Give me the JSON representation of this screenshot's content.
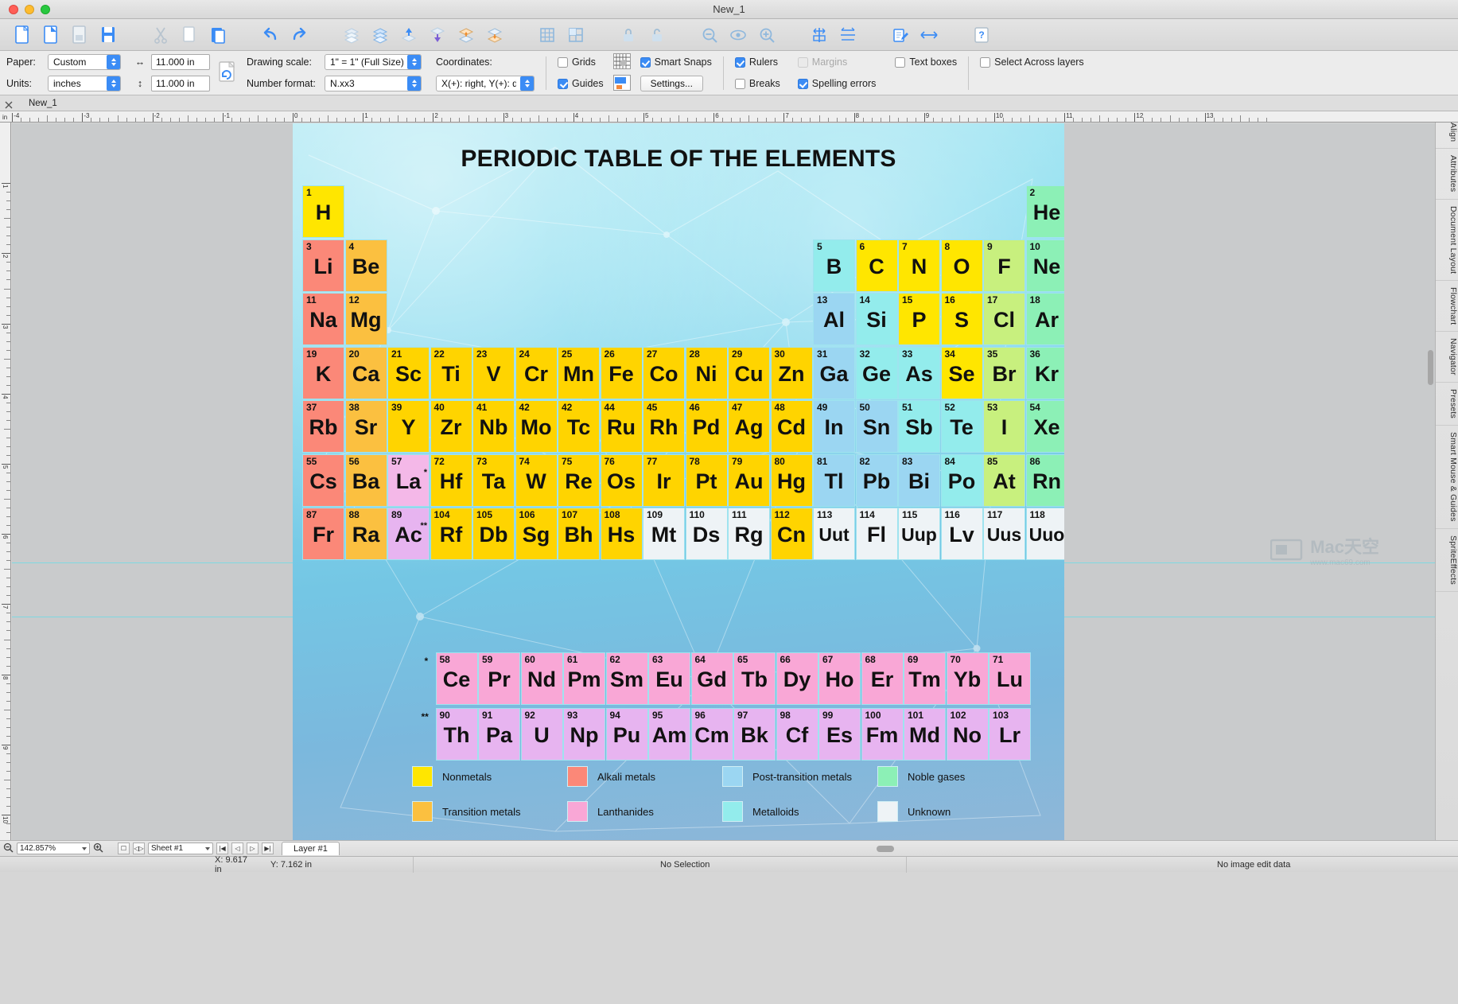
{
  "window": {
    "title": "New_1"
  },
  "titlebar": {
    "close": "close",
    "minimize": "minimize",
    "zoom": "zoom"
  },
  "toolbar": {
    "buttons": [
      {
        "name": "new-document-icon",
        "label": "New"
      },
      {
        "name": "new-from-template-icon",
        "label": "New from template"
      },
      {
        "name": "open-document-icon",
        "label": "Open"
      },
      {
        "name": "save-document-icon",
        "label": "Save"
      },
      {
        "name": "cut-icon",
        "label": "Cut"
      },
      {
        "name": "copy-icon",
        "label": "Copy"
      },
      {
        "name": "paste-icon",
        "label": "Paste"
      },
      {
        "name": "undo-icon",
        "label": "Undo"
      },
      {
        "name": "redo-icon",
        "label": "Redo"
      },
      {
        "name": "bring-to-front-icon",
        "label": "Bring to front"
      },
      {
        "name": "send-to-back-icon",
        "label": "Send to back"
      },
      {
        "name": "bring-forward-icon",
        "label": "Bring forward"
      },
      {
        "name": "send-backward-icon",
        "label": "Send backward"
      },
      {
        "name": "group-icon",
        "label": "Group"
      },
      {
        "name": "ungroup-icon",
        "label": "Ungroup"
      },
      {
        "name": "grid-icon",
        "label": "Grid"
      },
      {
        "name": "grid-settings-icon",
        "label": "Grid settings"
      },
      {
        "name": "lock-icon",
        "label": "Lock"
      },
      {
        "name": "unlock-icon",
        "label": "Unlock"
      },
      {
        "name": "zoom-out-icon",
        "label": "Zoom out"
      },
      {
        "name": "preview-icon",
        "label": "Preview"
      },
      {
        "name": "zoom-in-icon",
        "label": "Zoom in"
      },
      {
        "name": "align-vertical-icon",
        "label": "Align vertical"
      },
      {
        "name": "align-horizontal-icon",
        "label": "Align horizontal"
      },
      {
        "name": "edit-text-icon",
        "label": "Edit text"
      },
      {
        "name": "link-icon",
        "label": "Link"
      },
      {
        "name": "help-icon",
        "label": "Help"
      }
    ]
  },
  "options": {
    "paper_label": "Paper:",
    "paper_value": "Custom",
    "units_label": "Units:",
    "units_value": "inches",
    "width_value": "11.000 in",
    "height_value": "11.000 in",
    "rotate_page_icon": "rotate-page-icon",
    "drawing_scale_label": "Drawing scale:",
    "drawing_scale_value": "1\" = 1\"   (Full Size)",
    "number_format_label": "Number format:",
    "number_format_value": "N.xx3",
    "coordinates_label": "Coordinates:",
    "coordinates_value": "X(+): right, Y(+): down",
    "checks": [
      {
        "label": "Grids",
        "checked": false,
        "disabled": false
      },
      {
        "label": "Guides",
        "checked": true,
        "disabled": false
      },
      {
        "label": "Smart Snaps",
        "checked": true,
        "disabled": false
      },
      {
        "label": "Rulers",
        "checked": true,
        "disabled": false
      },
      {
        "label": "Breaks",
        "checked": false,
        "disabled": false
      },
      {
        "label": "Margins",
        "checked": false,
        "disabled": true
      },
      {
        "label": "Spelling errors",
        "checked": true,
        "disabled": false
      },
      {
        "label": "Text boxes",
        "checked": false,
        "disabled": false
      },
      {
        "label": "Select Across layers",
        "checked": false,
        "disabled": false
      }
    ],
    "settings_button": "Settings...",
    "grid_preview_icon": "grid-preview-icon",
    "guide_preview_icon": "guide-preview-icon"
  },
  "tabs": {
    "close_icon": "close-tab-icon",
    "document_tab": "New_1"
  },
  "right_panel": {
    "tabs": [
      "Align",
      "Attributes",
      "Document Layout",
      "Flowchart",
      "Navigator",
      "Presets",
      "Smart Mouse & Guides",
      "SpriteEffects"
    ]
  },
  "bottom": {
    "zoom_value": "142.857%",
    "zoom_out_icon": "zoom-out-icon",
    "zoom_in_icon": "zoom-in-icon",
    "page_icon": "page-icon",
    "page_nav_icon": "page-nav-icon",
    "sheet_value": "Sheet #1",
    "nav_first": "|◀",
    "nav_prev": "◁",
    "nav_next": "▷",
    "nav_last": "▶|",
    "layer_tab": "Layer #1"
  },
  "statusbar": {
    "x_coord": "X: 9.617 in",
    "y_coord": "Y: 7.162 in",
    "selection": "No Selection",
    "image_edit": "No image edit data"
  },
  "watermark": {
    "brand": "Mac天空",
    "url": "www.mac69.com"
  },
  "document": {
    "title": "PERIODIC TABLE OF THE ELEMENTS",
    "colors": {
      "nonmetals": "#ffe600",
      "alkali_metals": "#fb8878",
      "post_transition": "#9bd6f2",
      "noble_gases": "#8cf0b6",
      "transition_metals": "#fbc93b",
      "lanthanides": "#f9a7d6",
      "metalloids": "#93ecec",
      "unknown": "#eef3f6",
      "alkaline_earth": "#fbc040",
      "actinides": "#e7b4f0",
      "halogens": "#c8f07e",
      "border": "#9fe3ef"
    },
    "legend": [
      {
        "label": "Nonmetals",
        "color": "#ffe600"
      },
      {
        "label": "Alkali metals",
        "color": "#fb8878"
      },
      {
        "label": "Post-transition metals",
        "color": "#9bd6f2"
      },
      {
        "label": "Noble gases",
        "color": "#8cf0b6"
      },
      {
        "label": "Transition metals",
        "color": "#fbc040"
      },
      {
        "label": "Lanthanides",
        "color": "#f9a7d6"
      },
      {
        "label": "Metalloids",
        "color": "#93ecec"
      },
      {
        "label": "Unknown",
        "color": "#eef3f6"
      }
    ],
    "markers": {
      "lanthanide_mark": "*",
      "actinide_mark": "**"
    },
    "elements": [
      {
        "num": "1",
        "sym": "H",
        "col": 1,
        "row": 1,
        "color": "#ffe600"
      },
      {
        "num": "2",
        "sym": "He",
        "col": 18,
        "row": 1,
        "color": "#8cf0b6"
      },
      {
        "num": "3",
        "sym": "Li",
        "col": 1,
        "row": 2,
        "color": "#fb8878"
      },
      {
        "num": "4",
        "sym": "Be",
        "col": 2,
        "row": 2,
        "color": "#fbc040"
      },
      {
        "num": "5",
        "sym": "B",
        "col": 13,
        "row": 2,
        "color": "#93ecec"
      },
      {
        "num": "6",
        "sym": "C",
        "col": 14,
        "row": 2,
        "color": "#ffe600"
      },
      {
        "num": "7",
        "sym": "N",
        "col": 15,
        "row": 2,
        "color": "#ffe600"
      },
      {
        "num": "8",
        "sym": "O",
        "col": 16,
        "row": 2,
        "color": "#ffe600"
      },
      {
        "num": "9",
        "sym": "F",
        "col": 17,
        "row": 2,
        "color": "#c8f07e"
      },
      {
        "num": "10",
        "sym": "Ne",
        "col": 18,
        "row": 2,
        "color": "#8cf0b6"
      },
      {
        "num": "11",
        "sym": "Na",
        "col": 1,
        "row": 3,
        "color": "#fb8878"
      },
      {
        "num": "12",
        "sym": "Mg",
        "col": 2,
        "row": 3,
        "color": "#fbc040"
      },
      {
        "num": "13",
        "sym": "Al",
        "col": 13,
        "row": 3,
        "color": "#9bd6f2"
      },
      {
        "num": "14",
        "sym": "Si",
        "col": 14,
        "row": 3,
        "color": "#93ecec"
      },
      {
        "num": "15",
        "sym": "P",
        "col": 15,
        "row": 3,
        "color": "#ffe600"
      },
      {
        "num": "16",
        "sym": "S",
        "col": 16,
        "row": 3,
        "color": "#ffe600"
      },
      {
        "num": "17",
        "sym": "Cl",
        "col": 17,
        "row": 3,
        "color": "#c8f07e"
      },
      {
        "num": "18",
        "sym": "Ar",
        "col": 18,
        "row": 3,
        "color": "#8cf0b6"
      },
      {
        "num": "19",
        "sym": "K",
        "col": 1,
        "row": 4,
        "color": "#fb8878"
      },
      {
        "num": "20",
        "sym": "Ca",
        "col": 2,
        "row": 4,
        "color": "#fbc040"
      },
      {
        "num": "21",
        "sym": "Sc",
        "col": 3,
        "row": 4,
        "color": "#ffd400"
      },
      {
        "num": "22",
        "sym": "Ti",
        "col": 4,
        "row": 4,
        "color": "#ffd400"
      },
      {
        "num": "23",
        "sym": "V",
        "col": 5,
        "row": 4,
        "color": "#ffd400"
      },
      {
        "num": "24",
        "sym": "Cr",
        "col": 6,
        "row": 4,
        "color": "#ffd400"
      },
      {
        "num": "25",
        "sym": "Mn",
        "col": 7,
        "row": 4,
        "color": "#ffd400"
      },
      {
        "num": "26",
        "sym": "Fe",
        "col": 8,
        "row": 4,
        "color": "#ffd400"
      },
      {
        "num": "27",
        "sym": "Co",
        "col": 9,
        "row": 4,
        "color": "#ffd400"
      },
      {
        "num": "28",
        "sym": "Ni",
        "col": 10,
        "row": 4,
        "color": "#ffd400"
      },
      {
        "num": "29",
        "sym": "Cu",
        "col": 11,
        "row": 4,
        "color": "#ffd400"
      },
      {
        "num": "30",
        "sym": "Zn",
        "col": 12,
        "row": 4,
        "color": "#ffd400"
      },
      {
        "num": "31",
        "sym": "Ga",
        "col": 13,
        "row": 4,
        "color": "#9bd6f2"
      },
      {
        "num": "32",
        "sym": "Ge",
        "col": 14,
        "row": 4,
        "color": "#93ecec"
      },
      {
        "num": "33",
        "sym": "As",
        "col": 15,
        "row": 4,
        "color": "#93ecec"
      },
      {
        "num": "34",
        "sym": "Se",
        "col": 16,
        "row": 4,
        "color": "#ffe600"
      },
      {
        "num": "35",
        "sym": "Br",
        "col": 17,
        "row": 4,
        "color": "#c8f07e"
      },
      {
        "num": "36",
        "sym": "Kr",
        "col": 18,
        "row": 4,
        "color": "#8cf0b6"
      },
      {
        "num": "37",
        "sym": "Rb",
        "col": 1,
        "row": 5,
        "color": "#fb8878"
      },
      {
        "num": "38",
        "sym": "Sr",
        "col": 2,
        "row": 5,
        "color": "#fbc040"
      },
      {
        "num": "39",
        "sym": "Y",
        "col": 3,
        "row": 5,
        "color": "#ffd400"
      },
      {
        "num": "40",
        "sym": "Zr",
        "col": 4,
        "row": 5,
        "color": "#ffd400"
      },
      {
        "num": "41",
        "sym": "Nb",
        "col": 5,
        "row": 5,
        "color": "#ffd400"
      },
      {
        "num": "42",
        "sym": "Mo",
        "col": 6,
        "row": 5,
        "color": "#ffd400"
      },
      {
        "num": "42",
        "sym": "Tc",
        "col": 7,
        "row": 5,
        "color": "#ffd400"
      },
      {
        "num": "44",
        "sym": "Ru",
        "col": 8,
        "row": 5,
        "color": "#ffd400"
      },
      {
        "num": "45",
        "sym": "Rh",
        "col": 9,
        "row": 5,
        "color": "#ffd400"
      },
      {
        "num": "46",
        "sym": "Pd",
        "col": 10,
        "row": 5,
        "color": "#ffd400"
      },
      {
        "num": "47",
        "sym": "Ag",
        "col": 11,
        "row": 5,
        "color": "#ffd400"
      },
      {
        "num": "48",
        "sym": "Cd",
        "col": 12,
        "row": 5,
        "color": "#ffd400"
      },
      {
        "num": "49",
        "sym": "In",
        "col": 13,
        "row": 5,
        "color": "#9bd6f2"
      },
      {
        "num": "50",
        "sym": "Sn",
        "col": 14,
        "row": 5,
        "color": "#9bd6f2"
      },
      {
        "num": "51",
        "sym": "Sb",
        "col": 15,
        "row": 5,
        "color": "#93ecec"
      },
      {
        "num": "52",
        "sym": "Te",
        "col": 16,
        "row": 5,
        "color": "#93ecec"
      },
      {
        "num": "53",
        "sym": "I",
        "col": 17,
        "row": 5,
        "color": "#c8f07e"
      },
      {
        "num": "54",
        "sym": "Xe",
        "col": 18,
        "row": 5,
        "color": "#8cf0b6"
      },
      {
        "num": "55",
        "sym": "Cs",
        "col": 1,
        "row": 6,
        "color": "#fb8878"
      },
      {
        "num": "56",
        "sym": "Ba",
        "col": 2,
        "row": 6,
        "color": "#fbc040"
      },
      {
        "num": "57",
        "sym": "La",
        "col": 3,
        "row": 6,
        "color": "#f4b8e8",
        "star": "*"
      },
      {
        "num": "72",
        "sym": "Hf",
        "col": 4,
        "row": 6,
        "color": "#ffd400"
      },
      {
        "num": "73",
        "sym": "Ta",
        "col": 5,
        "row": 6,
        "color": "#ffd400"
      },
      {
        "num": "74",
        "sym": "W",
        "col": 6,
        "row": 6,
        "color": "#ffd400"
      },
      {
        "num": "75",
        "sym": "Re",
        "col": 7,
        "row": 6,
        "color": "#ffd400"
      },
      {
        "num": "76",
        "sym": "Os",
        "col": 8,
        "row": 6,
        "color": "#ffd400"
      },
      {
        "num": "77",
        "sym": "Ir",
        "col": 9,
        "row": 6,
        "color": "#ffd400"
      },
      {
        "num": "78",
        "sym": "Pt",
        "col": 10,
        "row": 6,
        "color": "#ffd400"
      },
      {
        "num": "79",
        "sym": "Au",
        "col": 11,
        "row": 6,
        "color": "#ffd400"
      },
      {
        "num": "80",
        "sym": "Hg",
        "col": 12,
        "row": 6,
        "color": "#ffd400"
      },
      {
        "num": "81",
        "sym": "Tl",
        "col": 13,
        "row": 6,
        "color": "#9bd6f2"
      },
      {
        "num": "82",
        "sym": "Pb",
        "col": 14,
        "row": 6,
        "color": "#9bd6f2"
      },
      {
        "num": "83",
        "sym": "Bi",
        "col": 15,
        "row": 6,
        "color": "#9bd6f2"
      },
      {
        "num": "84",
        "sym": "Po",
        "col": 16,
        "row": 6,
        "color": "#93ecec"
      },
      {
        "num": "85",
        "sym": "At",
        "col": 17,
        "row": 6,
        "color": "#c8f07e"
      },
      {
        "num": "86",
        "sym": "Rn",
        "col": 18,
        "row": 6,
        "color": "#8cf0b6"
      },
      {
        "num": "87",
        "sym": "Fr",
        "col": 1,
        "row": 7,
        "color": "#fb8878"
      },
      {
        "num": "88",
        "sym": "Ra",
        "col": 2,
        "row": 7,
        "color": "#fbc040"
      },
      {
        "num": "89",
        "sym": "Ac",
        "col": 3,
        "row": 7,
        "color": "#e7b4f0",
        "star": "**"
      },
      {
        "num": "104",
        "sym": "Rf",
        "col": 4,
        "row": 7,
        "color": "#ffd400"
      },
      {
        "num": "105",
        "sym": "Db",
        "col": 5,
        "row": 7,
        "color": "#ffd400"
      },
      {
        "num": "106",
        "sym": "Sg",
        "col": 6,
        "row": 7,
        "color": "#ffd400"
      },
      {
        "num": "107",
        "sym": "Bh",
        "col": 7,
        "row": 7,
        "color": "#ffd400"
      },
      {
        "num": "108",
        "sym": "Hs",
        "col": 8,
        "row": 7,
        "color": "#ffd400"
      },
      {
        "num": "109",
        "sym": "Mt",
        "col": 9,
        "row": 7,
        "color": "#eef3f6"
      },
      {
        "num": "110",
        "sym": "Ds",
        "col": 10,
        "row": 7,
        "color": "#eef3f6"
      },
      {
        "num": "111",
        "sym": "Rg",
        "col": 11,
        "row": 7,
        "color": "#eef3f6"
      },
      {
        "num": "112",
        "sym": "Cn",
        "col": 12,
        "row": 7,
        "color": "#ffd400"
      },
      {
        "num": "113",
        "sym": "Uut",
        "col": 13,
        "row": 7,
        "color": "#eef3f6"
      },
      {
        "num": "114",
        "sym": "Fl",
        "col": 14,
        "row": 7,
        "color": "#eef3f6"
      },
      {
        "num": "115",
        "sym": "Uup",
        "col": 15,
        "row": 7,
        "color": "#eef3f6"
      },
      {
        "num": "116",
        "sym": "Lv",
        "col": 16,
        "row": 7,
        "color": "#eef3f6"
      },
      {
        "num": "117",
        "sym": "Uus",
        "col": 17,
        "row": 7,
        "color": "#eef3f6"
      },
      {
        "num": "118",
        "sym": "Uuo",
        "col": 18,
        "row": 7,
        "color": "#eef3f6"
      }
    ],
    "lanthanides": [
      {
        "num": "58",
        "sym": "Ce"
      },
      {
        "num": "59",
        "sym": "Pr"
      },
      {
        "num": "60",
        "sym": "Nd"
      },
      {
        "num": "61",
        "sym": "Pm"
      },
      {
        "num": "62",
        "sym": "Sm"
      },
      {
        "num": "63",
        "sym": "Eu"
      },
      {
        "num": "64",
        "sym": "Gd"
      },
      {
        "num": "65",
        "sym": "Tb"
      },
      {
        "num": "66",
        "sym": "Dy"
      },
      {
        "num": "67",
        "sym": "Ho"
      },
      {
        "num": "68",
        "sym": "Er"
      },
      {
        "num": "69",
        "sym": "Tm"
      },
      {
        "num": "70",
        "sym": "Yb"
      },
      {
        "num": "71",
        "sym": "Lu"
      }
    ],
    "actinides": [
      {
        "num": "90",
        "sym": "Th"
      },
      {
        "num": "91",
        "sym": "Pa"
      },
      {
        "num": "92",
        "sym": "U"
      },
      {
        "num": "93",
        "sym": "Np"
      },
      {
        "num": "94",
        "sym": "Pu"
      },
      {
        "num": "95",
        "sym": "Am"
      },
      {
        "num": "96",
        "sym": "Cm"
      },
      {
        "num": "97",
        "sym": "Bk"
      },
      {
        "num": "98",
        "sym": "Cf"
      },
      {
        "num": "99",
        "sym": "Es"
      },
      {
        "num": "100",
        "sym": "Fm"
      },
      {
        "num": "101",
        "sym": "Md"
      },
      {
        "num": "102",
        "sym": "No"
      },
      {
        "num": "103",
        "sym": "Lr"
      }
    ],
    "ruler": {
      "h_labels": [
        "-4",
        "-3",
        "-2",
        "-1",
        "0",
        "1",
        "2",
        "3",
        "4",
        "5",
        "6",
        "7",
        "8",
        "9",
        "10",
        "11",
        "12",
        "13"
      ],
      "v_labels": [
        "1",
        "2",
        "3",
        "4",
        "5",
        "6",
        "7",
        "8",
        "9",
        "10"
      ],
      "unit": "in"
    }
  }
}
